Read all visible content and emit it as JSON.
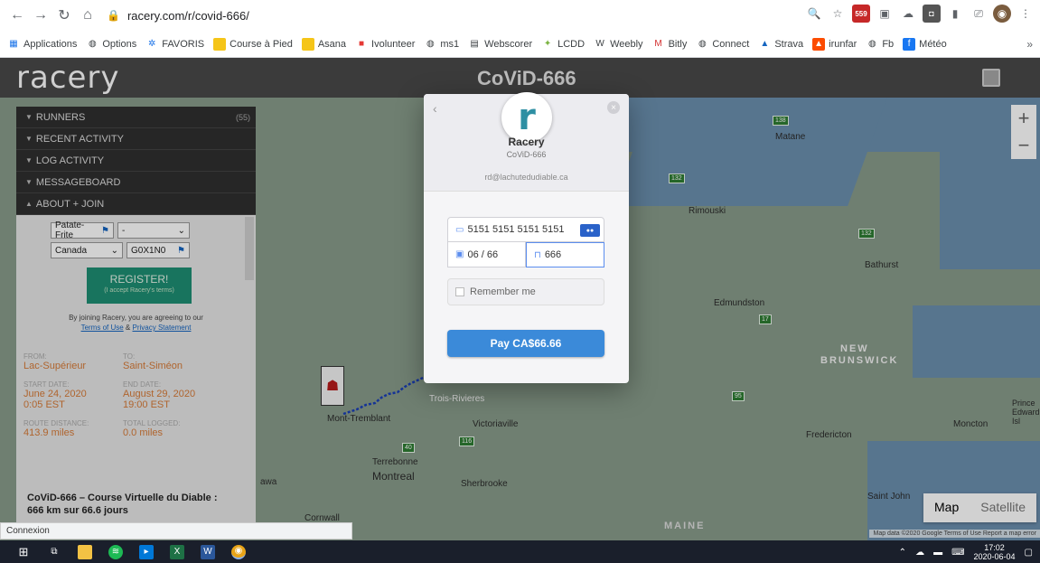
{
  "browser": {
    "url": "racery.com/r/covid-666/",
    "bookmarks": [
      "Applications",
      "Options",
      "FAVORIS",
      "Course à Pied",
      "Asana",
      "Ivolunteer",
      "ms1",
      "Webscorer",
      "LCDD",
      "Weebly",
      "Bitly",
      "Connect",
      "Strava",
      "irunfar",
      "Fb",
      "Météo"
    ],
    "bookmarks_more": "»",
    "ext_badge": "559"
  },
  "header": {
    "logo": "racery",
    "title": "CoViD-666"
  },
  "sidebar": {
    "items": [
      {
        "label": "RUNNERS",
        "count": "(55)",
        "tri": "▼"
      },
      {
        "label": "RECENT ACTIVITY",
        "count": "",
        "tri": "▼"
      },
      {
        "label": "LOG ACTIVITY",
        "count": "",
        "tri": "▼"
      },
      {
        "label": "MESSAGEBOARD",
        "count": "",
        "tri": "▼"
      },
      {
        "label": "ABOUT + JOIN",
        "count": "",
        "tri": "▲"
      }
    ],
    "form": {
      "team": "Patate-Frite",
      "team_option": "-",
      "country": "Canada",
      "postal": "G0X1N0"
    },
    "register_label": "REGISTER!",
    "register_sub": "(I accept Racery's terms)",
    "join_note": "By joining Racery, you are agreeing to our",
    "terms_link": "Terms of Use",
    "and_text": "&",
    "privacy_link": "Privacy Statement",
    "info": {
      "from_label": "FROM:",
      "from_value": "Lac-Supérieur",
      "to_label": "TO:",
      "to_value": "Saint-Siméon",
      "start_label": "START DATE:",
      "start_date": "June 24, 2020",
      "start_time": "0:05 EST",
      "end_label": "END DATE:",
      "end_date": "August 29, 2020",
      "end_time": "19:00 EST",
      "distance_label": "ROUTE DISTANCE:",
      "distance_value": "413.9 miles",
      "logged_label": "TOTAL LOGGED:",
      "logged_value": "0.0 miles"
    },
    "race_title": "CoViD-666 – Course Virtuelle du Diable :",
    "race_subtitle": "666 km sur 66.6 jours"
  },
  "map": {
    "labels": {
      "new_brunswick_1": "NEW",
      "new_brunswick_2": "BRUNSWICK",
      "maine": "MAINE",
      "trois_rivieres": "Trois-Rivieres",
      "victoriaville": "Victoriaville",
      "montreal": "Montreal",
      "terrebonne": "Terrebonne",
      "sherbrooke": "Sherbrooke",
      "fredericton": "Fredericton",
      "moncton": "Moncton",
      "saint_john": "Saint John",
      "edmundston": "Edmundston",
      "rimouski": "Rimouski",
      "matane": "Matane",
      "bathurst": "Bathurst",
      "prince_edward": "Prince Edward Isl",
      "mont_tremblant": "Mont-Tremblant",
      "cornwall": "Cornwall",
      "ottawa": "awa"
    },
    "zoom_in": "+",
    "zoom_out": "−",
    "map_type_map": "Map",
    "map_type_satellite": "Satellite",
    "credit": "Map data ©2020 Google   Terms of Use   Report a map error"
  },
  "modal": {
    "logo_letter": "r",
    "name": "Racery",
    "description": "CoViD-666",
    "email": "rd@lachutedudiable.ca",
    "card_number": "5151 5151 5151 5151",
    "expiry": "06 / 66",
    "cvc": "666",
    "remember_label": "Remember me",
    "pay_label": "Pay CA$66.66",
    "back": "‹",
    "close": "×"
  },
  "status_bar": "Connexion",
  "taskbar": {
    "time": "17:02",
    "date": "2020-06-04"
  }
}
